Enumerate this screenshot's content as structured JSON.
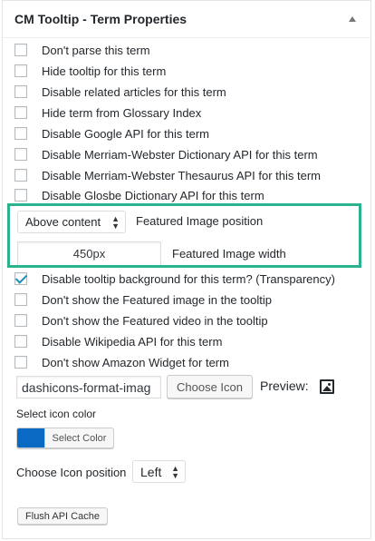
{
  "panel": {
    "title": "CM Tooltip - Term Properties"
  },
  "options_top": [
    {
      "label": "Don't parse this term",
      "checked": false
    },
    {
      "label": "Hide tooltip for this term",
      "checked": false
    },
    {
      "label": "Disable related articles for this term",
      "checked": false
    },
    {
      "label": "Hide term from Glossary Index",
      "checked": false
    },
    {
      "label": "Disable Google API for this term",
      "checked": false
    },
    {
      "label": "Disable Merriam-Webster Dictionary API for this term",
      "checked": false
    },
    {
      "label": "Disable Merriam-Webster Thesaurus API for this term",
      "checked": false
    },
    {
      "label": "Disable Glosbe Dictionary API for this term",
      "checked": false
    }
  ],
  "featured_image": {
    "position_value": "Above content",
    "position_label": "Featured Image position",
    "width_value": "450px",
    "width_label": "Featured Image width",
    "highlight_color": "#2bb28f"
  },
  "options_bottom": [
    {
      "label": "Disable tooltip background for this term? (Transparency)",
      "checked": true
    },
    {
      "label": "Don't show the Featured image in the tooltip",
      "checked": false
    },
    {
      "label": "Don't show the Featured video in the tooltip",
      "checked": false
    },
    {
      "label": "Disable Wikipedia API for this term",
      "checked": false
    },
    {
      "label": "Don't show Amazon Widget for term",
      "checked": false
    }
  ],
  "icon": {
    "value": "dashicons-format-imag",
    "choose_label": "Choose Icon",
    "preview_label": "Preview:",
    "preview_icon": "format-image-icon"
  },
  "icon_color": {
    "label": "Select icon color",
    "swatch_color": "#0a69c2",
    "button_label": "Select Color"
  },
  "icon_position": {
    "label": "Choose Icon position",
    "value": "Left"
  },
  "flush_label": "Flush API Cache"
}
